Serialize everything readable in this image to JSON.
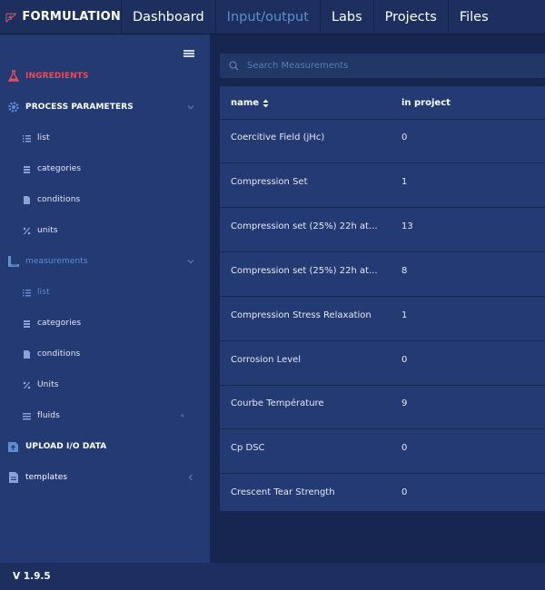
{
  "brand": {
    "name": "FORMULATION"
  },
  "nav": {
    "items": [
      {
        "label": "Dashboard",
        "active": false
      },
      {
        "label": "Input/output",
        "active": true
      },
      {
        "label": "Labs",
        "active": false
      },
      {
        "label": "Projects",
        "active": false
      },
      {
        "label": "Files",
        "active": false
      }
    ]
  },
  "sidebar": {
    "ingredients": {
      "label": "INGREDIENTS",
      "icon": "flask-icon"
    },
    "process": {
      "label": "PROCESS PARAMETERS",
      "icon": "gear-icon",
      "items": [
        {
          "label": "list",
          "icon": "list-icon"
        },
        {
          "label": "categories",
          "icon": "layers-icon"
        },
        {
          "label": "conditions",
          "icon": "file-icon"
        },
        {
          "label": "units",
          "icon": "percent-icon"
        }
      ]
    },
    "measurements": {
      "label": "measurements",
      "icon": "ruler-icon",
      "items": [
        {
          "label": "list",
          "icon": "list-icon"
        },
        {
          "label": "categories",
          "icon": "layers-icon"
        },
        {
          "label": "conditions",
          "icon": "file-icon"
        },
        {
          "label": "Units",
          "icon": "percent-icon"
        },
        {
          "label": "fluids",
          "icon": "list-icon"
        }
      ]
    },
    "upload": {
      "label": "UPLOAD I/O DATA",
      "icon": "upload-icon"
    },
    "templates": {
      "label": "templates",
      "icon": "file-icon"
    }
  },
  "search": {
    "placeholder": "Search Measurements",
    "value": ""
  },
  "table": {
    "columns": {
      "name": "name",
      "in_project": "in project"
    },
    "rows": [
      {
        "name": "Coercitive Field (jHc)",
        "in_project": "0"
      },
      {
        "name": "Compression Set",
        "in_project": "1"
      },
      {
        "name": "Compression set (25%) 22h at...",
        "in_project": "13"
      },
      {
        "name": "Compression set (25%) 22h at...",
        "in_project": "8"
      },
      {
        "name": "Compression Stress Relaxation",
        "in_project": "1"
      },
      {
        "name": "Corrosion Level",
        "in_project": "0"
      },
      {
        "name": "Courbe Température",
        "in_project": "9"
      },
      {
        "name": "Cp DSC",
        "in_project": "0"
      },
      {
        "name": "Crescent Tear Strength",
        "in_project": "0"
      }
    ]
  },
  "footer": {
    "version": "V 1.9.5"
  },
  "colors": {
    "background": "#162650",
    "sidebar": "#233a73",
    "accent_red": "#e84a5f",
    "accent_blue": "#5c8fd1"
  }
}
